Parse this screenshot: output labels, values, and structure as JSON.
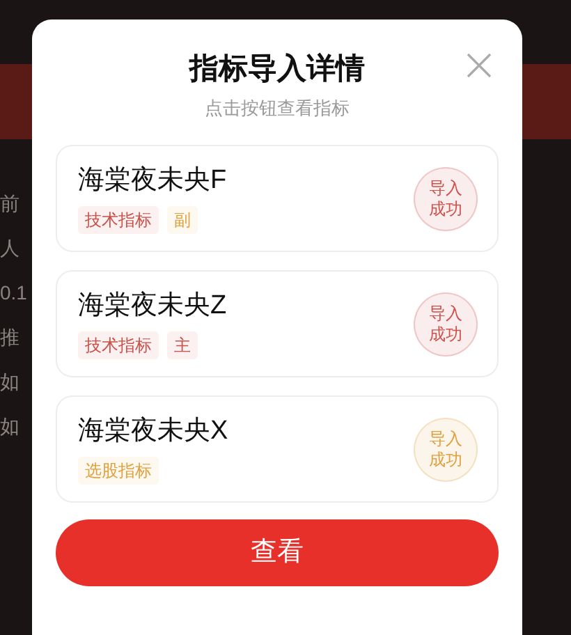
{
  "background": {
    "fragments": [
      "前",
      "人",
      "0.1",
      "推",
      "如",
      "如"
    ]
  },
  "dialog": {
    "title": "指标导入详情",
    "subtitle": "点击按钮查看指标",
    "items": [
      {
        "name": "海棠夜未央F",
        "tags": [
          {
            "label": "技术指标",
            "color": "#c9514a"
          },
          {
            "label": "副",
            "color": "#e0a03c"
          }
        ],
        "status": "导入成功",
        "color": "#d0504a"
      },
      {
        "name": "海棠夜未央Z",
        "tags": [
          {
            "label": "技术指标",
            "color": "#c9514a"
          },
          {
            "label": "主",
            "color": "#c9514a"
          }
        ],
        "status": "导入成功",
        "color": "#d0504a"
      },
      {
        "name": "海棠夜未央X",
        "tags": [
          {
            "label": "选股指标",
            "color": "#e0a03c"
          }
        ],
        "status": "导入成功",
        "color": "#e0a03c"
      }
    ],
    "button": "查看"
  }
}
